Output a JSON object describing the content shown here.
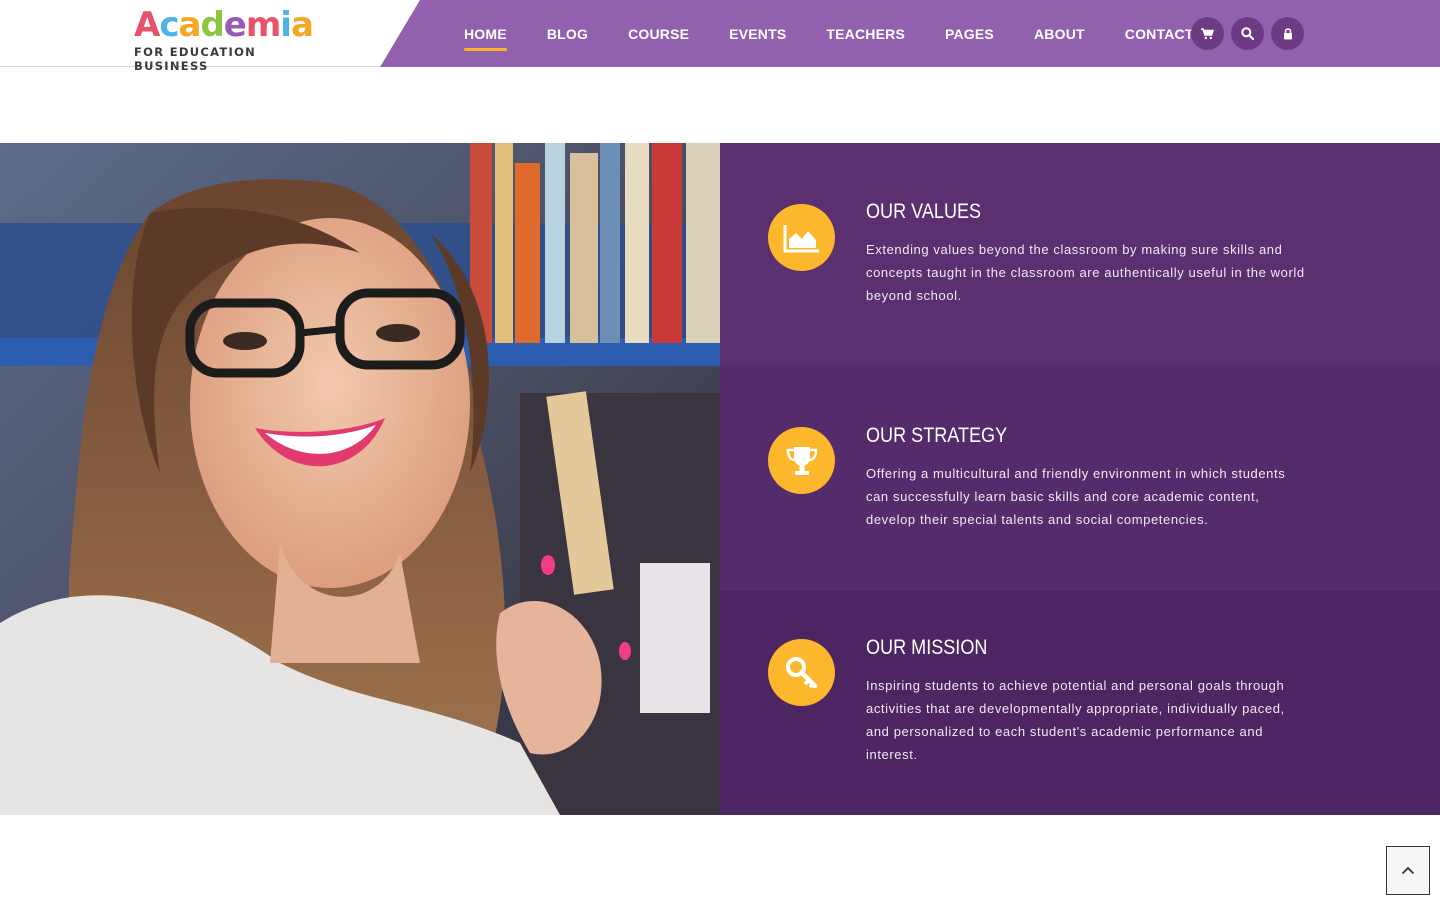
{
  "brand": {
    "name": "Academia",
    "tagline": "FOR EDUCATION BUSINESS",
    "letter_colors": [
      "#e8526b",
      "#4fb3e8",
      "#f5a623",
      "#8dc63f",
      "#9b59b6",
      "#e8526b",
      "#4fb3e8",
      "#f5a623"
    ]
  },
  "nav": {
    "items": [
      {
        "label": "HOME",
        "active": true
      },
      {
        "label": "BLOG",
        "active": false
      },
      {
        "label": "COURSE",
        "active": false
      },
      {
        "label": "EVENTS",
        "active": false
      },
      {
        "label": "TEACHERS",
        "active": false
      },
      {
        "label": "PAGES",
        "active": false
      },
      {
        "label": "ABOUT",
        "active": false
      },
      {
        "label": "CONTACT",
        "active": false
      }
    ],
    "icons": [
      "cart-icon",
      "search-icon",
      "lock-icon"
    ]
  },
  "features": [
    {
      "icon": "area-chart-icon",
      "title": "OUR VALUES",
      "text": "Extending values beyond the classroom by making sure skills and concepts taught in the classroom are authentically useful in the world beyond school."
    },
    {
      "icon": "trophy-icon",
      "title": "OUR STRATEGY",
      "text": "Offering a multicultural and friendly environment in which students can successfully learn basic skills and core academic content, develop their special talents and social competencies."
    },
    {
      "icon": "key-icon",
      "title": "OUR MISSION",
      "text": "Inspiring students to achieve potential and personal goals through activities that are developmentally appropriate, individually paced, and personalized to each student's academic performance and interest."
    }
  ],
  "colors": {
    "header_purple": "#9161ad",
    "accent_yellow": "#fdb72c",
    "panel_purple": "#5a3070"
  },
  "scroll_top": {
    "icon": "chevron-up-icon"
  }
}
